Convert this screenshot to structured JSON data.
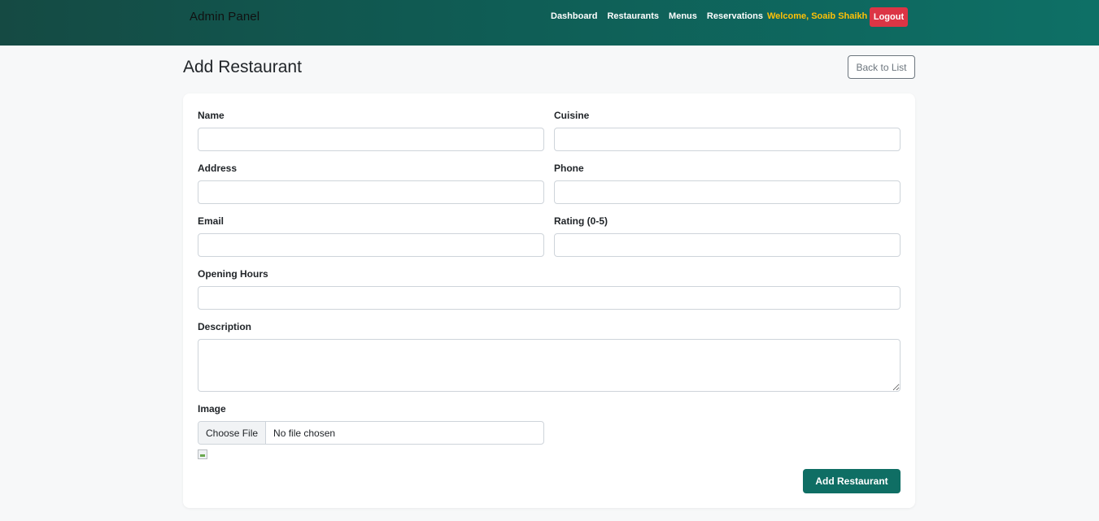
{
  "navbar": {
    "brand": "Admin Panel",
    "links": [
      "Dashboard",
      "Restaurants",
      "Menus",
      "Reservations"
    ],
    "welcome": "Welcome, Soaib Shaikh",
    "logout_label": "Logout"
  },
  "page": {
    "title": "Add Restaurant",
    "back_label": "Back to List"
  },
  "form": {
    "name_label": "Name",
    "name_value": "",
    "cuisine_label": "Cuisine",
    "cuisine_value": "",
    "address_label": "Address",
    "address_value": "",
    "phone_label": "Phone",
    "phone_value": "",
    "email_label": "Email",
    "email_value": "",
    "rating_label": "Rating (0-5)",
    "rating_value": "",
    "hours_label": "Opening Hours",
    "hours_value": "",
    "description_label": "Description",
    "description_value": "",
    "image_label": "Image",
    "choose_file_label": "Choose File",
    "file_status": "No file chosen",
    "submit_label": "Add Restaurant"
  },
  "icons": {
    "image_preview": "broken-image-icon"
  },
  "colors": {
    "nav_start": "#154a43",
    "nav_end": "#0e7066",
    "welcome": "#ffc107",
    "logout": "#dc3545",
    "primary": "#0f6e64"
  }
}
